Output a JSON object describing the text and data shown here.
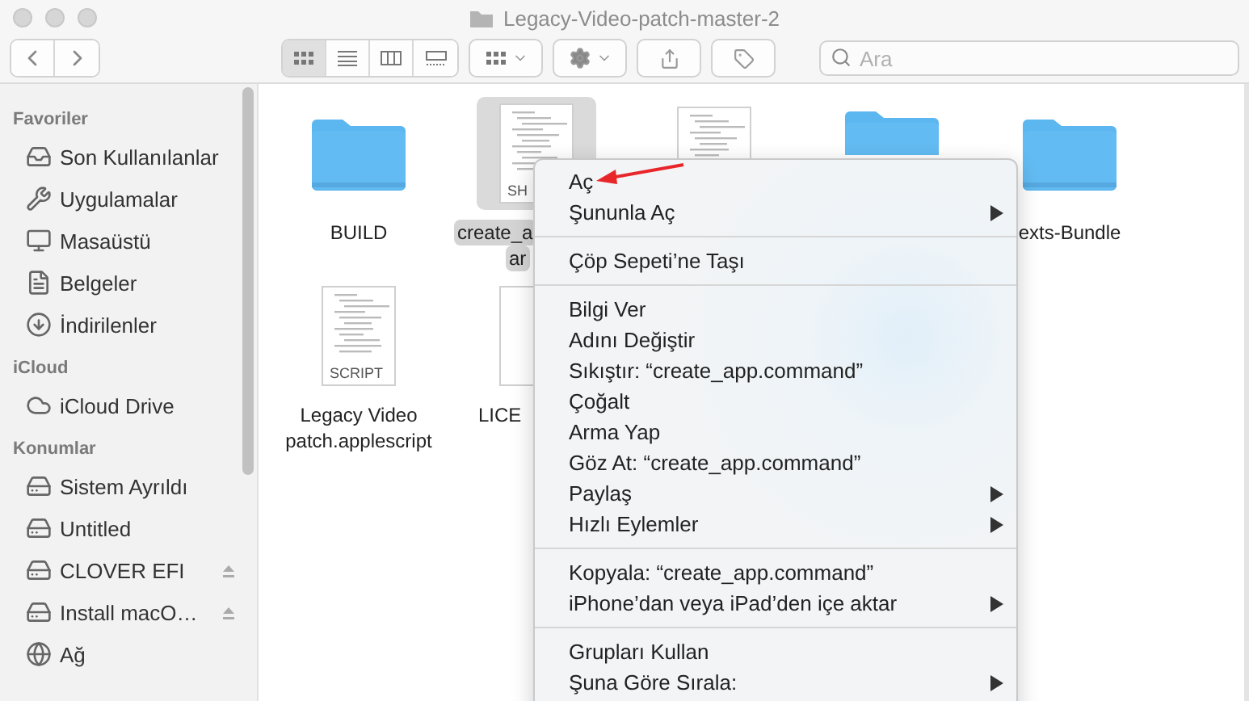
{
  "window": {
    "title": "Legacy-Video-patch-master-2"
  },
  "toolbar": {
    "views": [
      {
        "selected": true
      },
      {
        "selected": false
      },
      {
        "selected": false
      },
      {
        "selected": false
      }
    ],
    "search": {
      "placeholder": "Ara"
    }
  },
  "sidebar": {
    "sections": [
      {
        "heading": "Favoriler",
        "items": [
          {
            "label": "Son Kullanılanlar",
            "ejectable": false
          },
          {
            "label": "Uygulamalar",
            "ejectable": false
          },
          {
            "label": "Masaüstü",
            "ejectable": false
          },
          {
            "label": "Belgeler",
            "ejectable": false
          },
          {
            "label": "İndirilenler",
            "ejectable": false
          }
        ]
      },
      {
        "heading": "iCloud",
        "items": [
          {
            "label": "iCloud Drive",
            "ejectable": false
          }
        ]
      },
      {
        "heading": "Konumlar",
        "items": [
          {
            "label": "Sistem Ayrıldı",
            "ejectable": false
          },
          {
            "label": "Untitled",
            "ejectable": false
          },
          {
            "label": "CLOVER EFI",
            "ejectable": true
          },
          {
            "label": "Install macO…",
            "ejectable": true
          },
          {
            "label": "Ağ",
            "ejectable": false
          }
        ]
      }
    ]
  },
  "files": [
    {
      "kind": "folder",
      "label": [
        "BUILD"
      ],
      "selected": false
    },
    {
      "kind": "document",
      "badge": "SH",
      "label": [
        "create_a",
        "ar"
      ],
      "selected": true
    },
    {
      "kind": "document",
      "selected": false
    },
    {
      "kind": "folder",
      "selected": false
    },
    {
      "kind": "folder",
      "label": [
        "exts-Bundle"
      ],
      "selected": false
    },
    {
      "kind": "document",
      "badge": "SCRIPT",
      "label": [
        "Legacy Video",
        "patch.applescript"
      ],
      "selected": false
    },
    {
      "kind": "blank",
      "label": [
        "LICE"
      ],
      "selected": false
    }
  ],
  "context_menu": {
    "groups": [
      [
        {
          "label": "Aç",
          "submenu": false
        },
        {
          "label": "Şununla Aç",
          "submenu": true
        }
      ],
      [
        {
          "label": "Çöp Sepeti’ne Taşı",
          "submenu": false
        }
      ],
      [
        {
          "label": "Bilgi Ver",
          "submenu": false
        },
        {
          "label": "Adını Değiştir",
          "submenu": false
        },
        {
          "label": "Sıkıştır: “create_app.command”",
          "submenu": false
        },
        {
          "label": "Çoğalt",
          "submenu": false
        },
        {
          "label": "Arma Yap",
          "submenu": false
        },
        {
          "label": "Göz At: “create_app.command”",
          "submenu": false
        },
        {
          "label": "Paylaş",
          "submenu": true
        },
        {
          "label": "Hızlı Eylemler",
          "submenu": true
        }
      ],
      [
        {
          "label": "Kopyala: “create_app.command”",
          "submenu": false
        },
        {
          "label": "iPhone’dan veya iPad’den içe aktar",
          "submenu": true
        }
      ],
      [
        {
          "label": "Grupları Kullan",
          "submenu": false
        },
        {
          "label": "Şuna Göre Sırala:",
          "submenu": true
        }
      ]
    ]
  }
}
